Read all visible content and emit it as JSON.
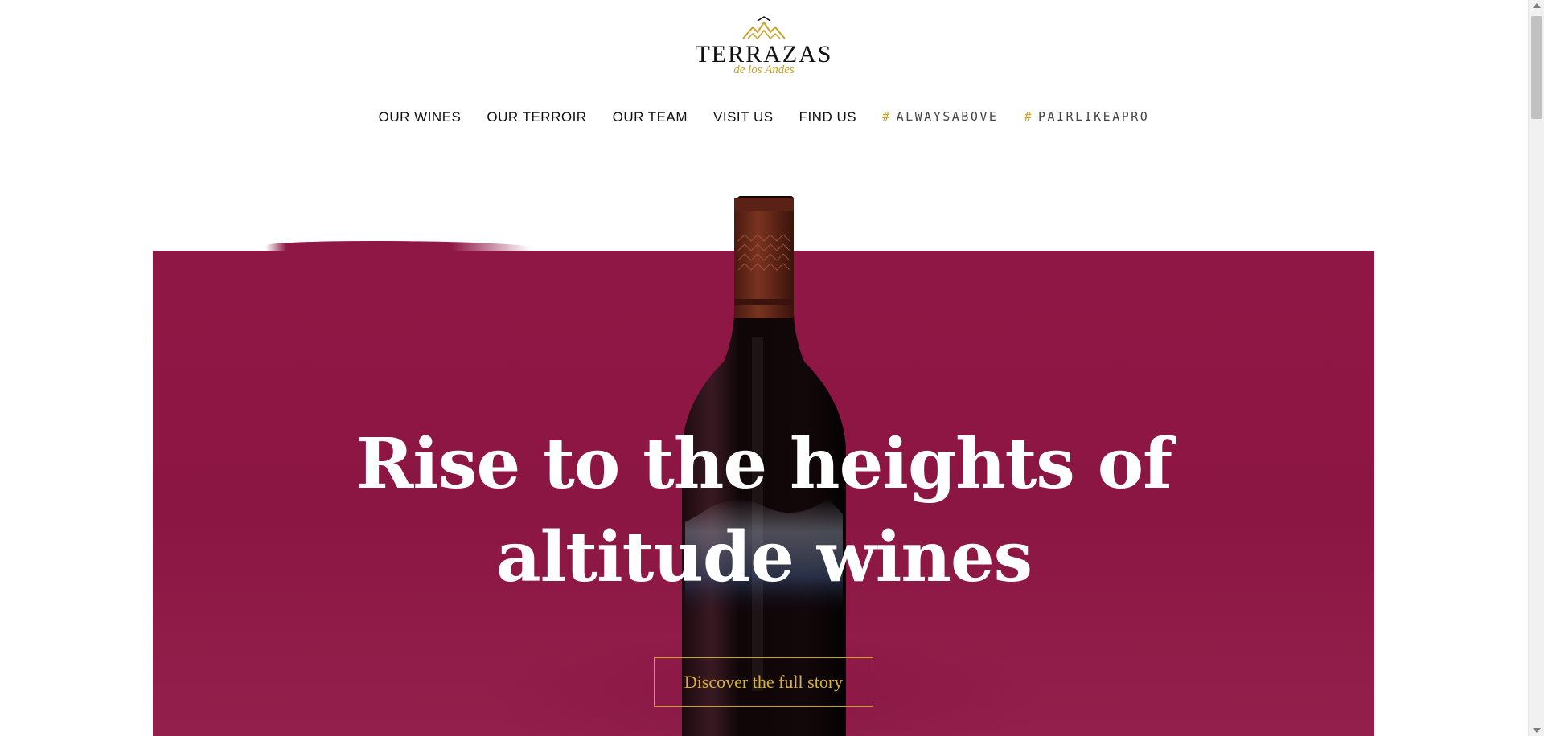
{
  "logo": {
    "wordmark": "TERRAZAS",
    "subline": "de los Andes",
    "icon": "mountain-logo-icon"
  },
  "nav": {
    "items": [
      {
        "label": "OUR WINES"
      },
      {
        "label": "OUR TERROIR"
      },
      {
        "label": "OUR TEAM"
      },
      {
        "label": "VISIT US"
      },
      {
        "label": "FIND US"
      },
      {
        "hash": "#",
        "label": "ALWAYSABOVE"
      },
      {
        "hash": "#",
        "label": "PAIRLIKEAPRO"
      }
    ]
  },
  "hero": {
    "headline_line1": "Rise to the heights of",
    "headline_line2": "altitude wines",
    "cta_label": "Discover the full story",
    "image": "wine-bottle-image"
  },
  "colors": {
    "accent_gold": "#c9a227",
    "hero_background": "#8f1745",
    "text": "#111111"
  }
}
